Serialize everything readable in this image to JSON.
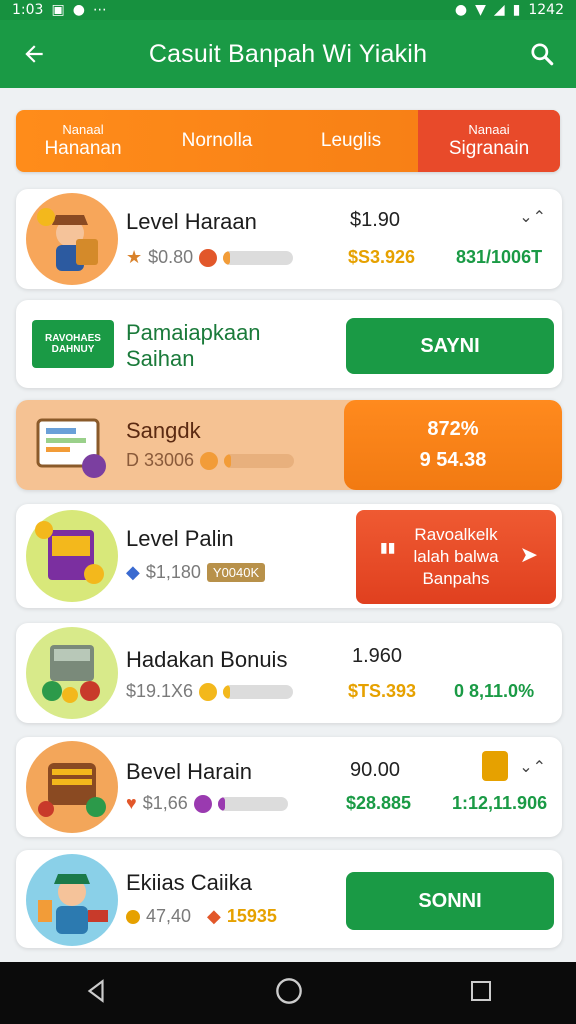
{
  "status": {
    "time": "1:03",
    "battery": "1242"
  },
  "header": {
    "title": "Casuit Banpah Wi Yiakih"
  },
  "tabs": [
    {
      "small": "Nanaal",
      "big": "Hananan"
    },
    {
      "small": "",
      "big": "Nornolla"
    },
    {
      "small": "",
      "big": "Leuglis"
    },
    {
      "small": "Nanaai",
      "big": "Sigranain"
    }
  ],
  "cards": {
    "c1": {
      "name": "Level Haraan",
      "sub": "$0.80",
      "price": "$1.90",
      "gold": "$S3.926",
      "green": "831/1006T",
      "corner": "⌄⌃",
      "progress": 0.1
    },
    "c2": {
      "badge": "RAVOHAES\nDAHNUY",
      "title1": "Pamaiapkaan",
      "title2": "Saihan",
      "button": "SAYNI"
    },
    "c3": {
      "name": "Sangdk",
      "sub": "D 33006",
      "percent": "872%",
      "value": "9 54.38",
      "progress": 0.1
    },
    "c4": {
      "name": "Level Palin",
      "sub": "$1,180",
      "tag": "Y0040K",
      "btn1": "Ravoalkelk",
      "btn2": "lalah balwa",
      "btn3": "Banpahs"
    },
    "c5": {
      "name": "Hadakan Bonuis",
      "sub": "$19.1X6",
      "price": "1.960",
      "gold": "$TS.393",
      "green": "0 8,11.0%",
      "progress": 0.1
    },
    "c6": {
      "name": "Bevel Harain",
      "sub": "$1,66",
      "price": "90.00",
      "green1": "$28.885",
      "green2": "1:12,11.906",
      "corner": "⌄⌃",
      "progress": 0.1
    },
    "c7": {
      "name": "Ekiias Caiika",
      "sub1": "47,40",
      "sub2": "15935",
      "button": "SONNI"
    }
  },
  "colors": {
    "green": "#1a9a45",
    "orange": "#f57c14",
    "red": "#e84a2a"
  }
}
